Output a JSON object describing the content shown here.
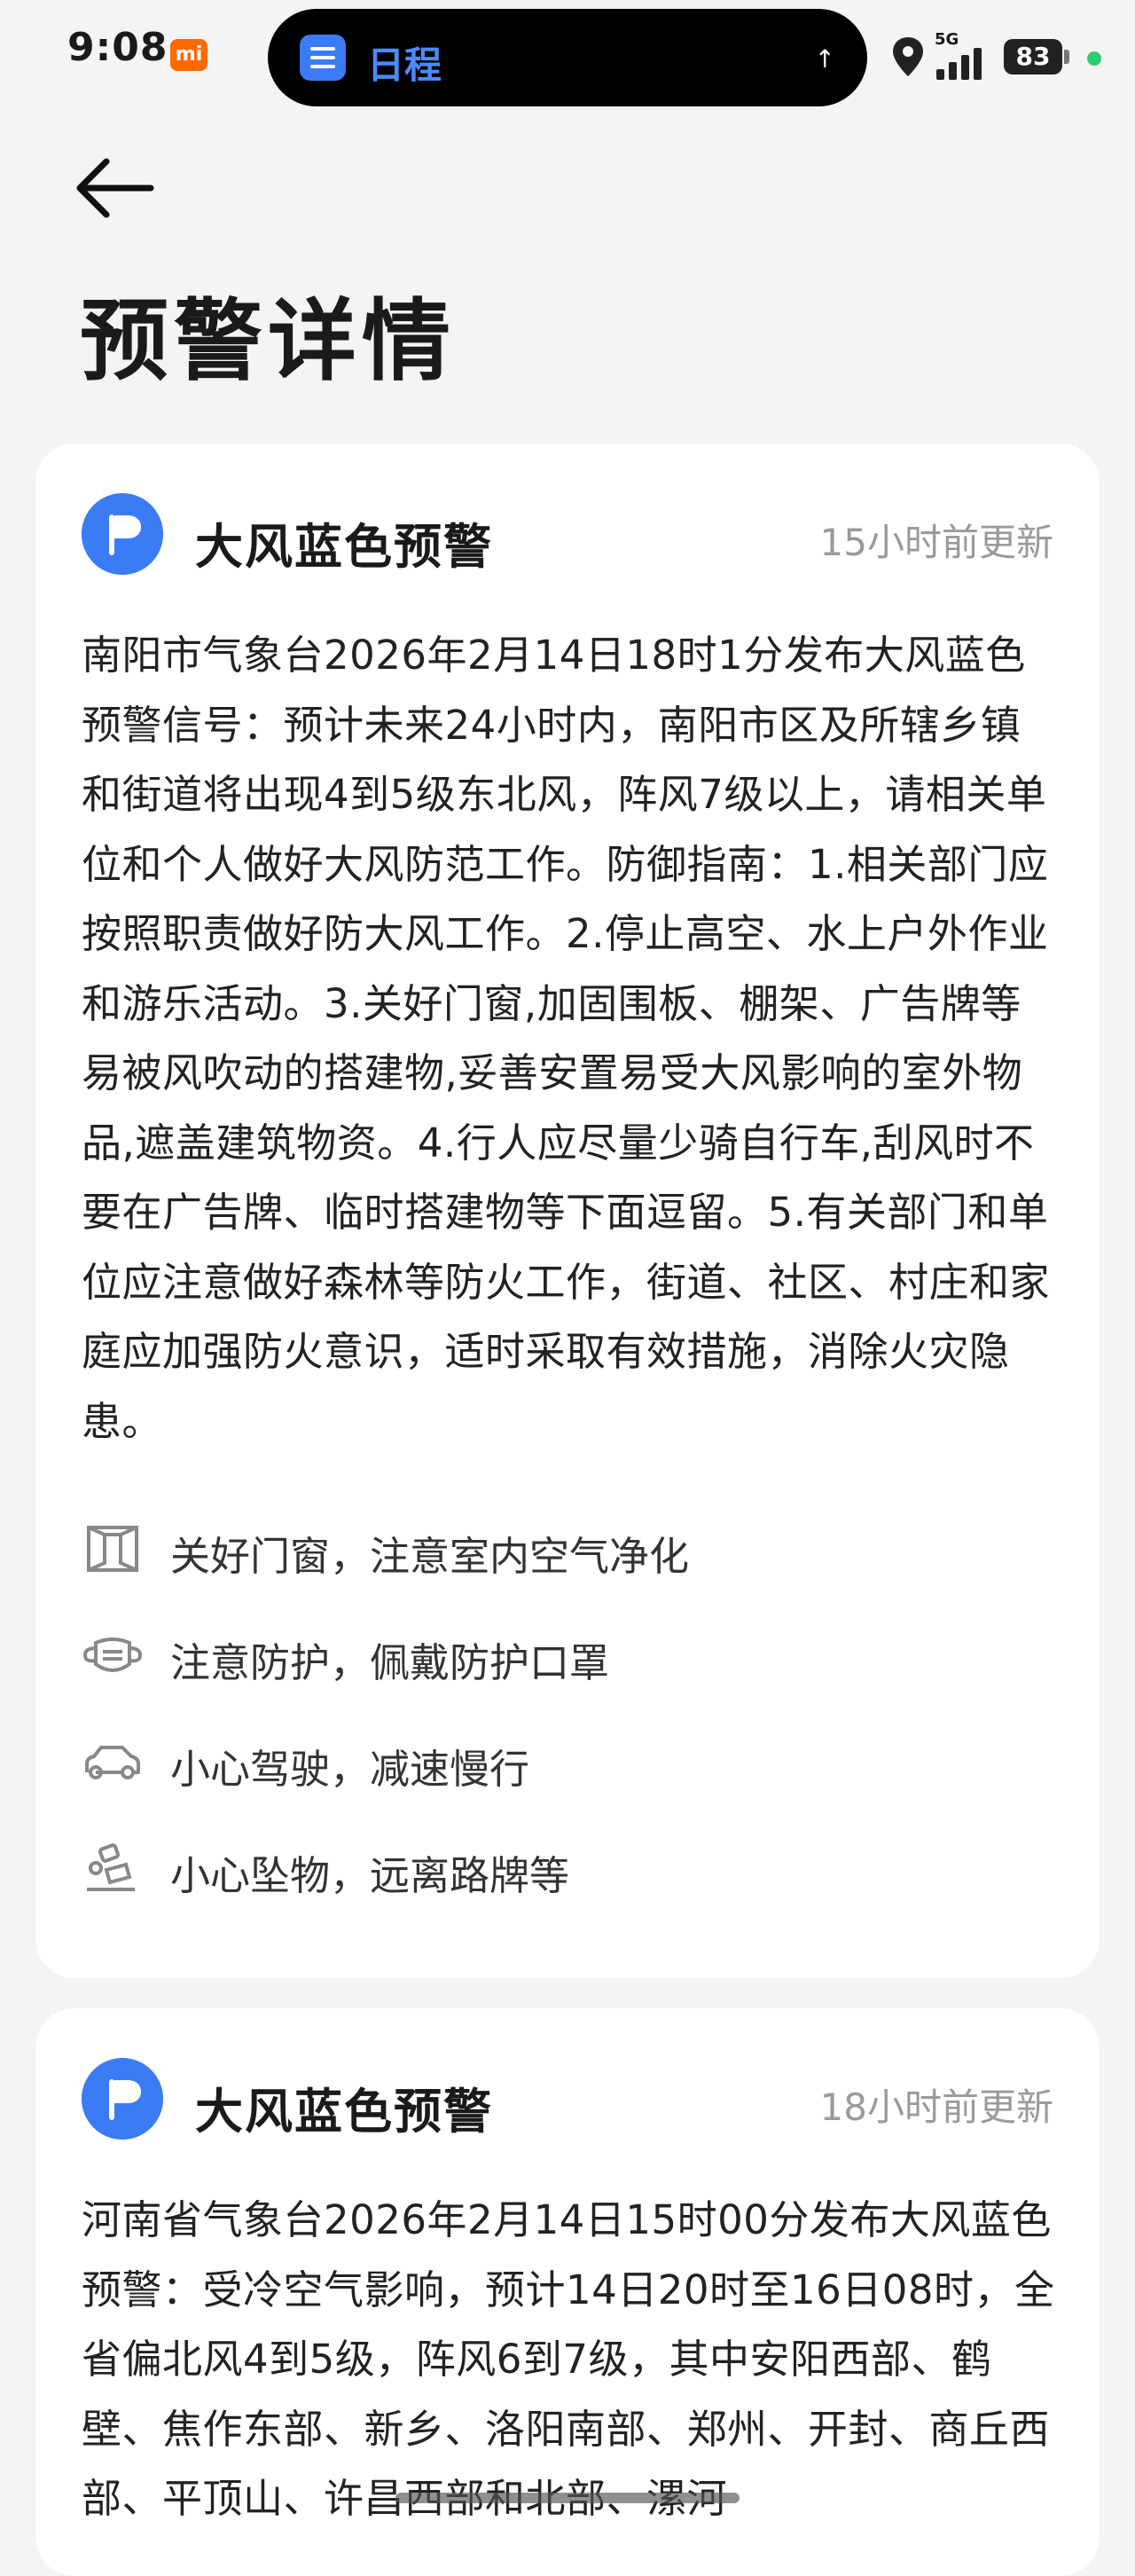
{
  "status_bar": {
    "time": "9:08",
    "island_app": "日程",
    "network": "5G",
    "battery": "83",
    "accent": "#3b7bf6"
  },
  "header": {
    "title": "预警详情"
  },
  "cards": [
    {
      "title": "大风蓝色预警",
      "updated": "15小时前更新",
      "body": "南阳市气象台2026年2月14日18时1分发布大风蓝色预警信号：预计未来24小时内，南阳市区及所辖乡镇和街道将出现4到5级东北风，阵风7级以上，请相关单位和个人做好大风防范工作。防御指南：1.相关部门应按照职责做好防大风工作。2.停止高空、水上户外作业和游乐活动。3.关好门窗,加固围板、棚架、广告牌等易被风吹动的搭建物,妥善安置易受大风影响的室外物品,遮盖建筑物资。4.行人应尽量少骑自行车,刮风时不要在广告牌、临时搭建物等下面逗留。5.有关部门和单位应注意做好森林等防火工作，街道、社区、村庄和家庭应加强防火意识，适时采取有效措施，消除火灾隐患。",
      "tips": [
        {
          "icon": "window-icon",
          "text": "关好门窗，注意室内空气净化"
        },
        {
          "icon": "mask-icon",
          "text": "注意防护，佩戴防护口罩"
        },
        {
          "icon": "car-icon",
          "text": "小心驾驶，减速慢行"
        },
        {
          "icon": "falling-object-icon",
          "text": "小心坠物，远离路牌等"
        }
      ]
    },
    {
      "title": "大风蓝色预警",
      "updated": "18小时前更新",
      "body": "河南省气象台2026年2月14日15时00分发布大风蓝色预警：受冷空气影响，预计14日20时至16日08时，全省偏北风4到5级，阵风6到7级，其中安阳西部、鹤壁、焦作东部、新乡、洛阳南部、郑州、开封、商丘西部、平顶山、许昌西部和北部、漯河"
    }
  ]
}
